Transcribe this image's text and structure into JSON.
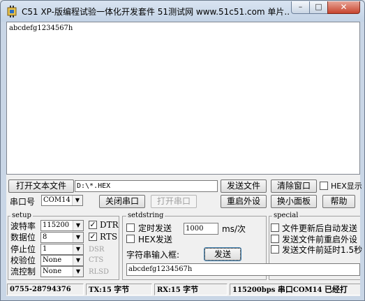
{
  "window": {
    "title": "C51 XP-版编程试验一体化开发套件 51测试网 www.51c51.com 单片...",
    "buttons": {
      "minimize": "–",
      "maximize": "□",
      "close": "✕"
    }
  },
  "receive_area": {
    "text": "abcdefg1234567h"
  },
  "row1": {
    "open_file_label": "打开文本文件",
    "file_path": "D:\\*.HEX",
    "send_file_label": "发送文件",
    "clear_window_label": "清除窗口",
    "hex_display_label": "HEX显示"
  },
  "row2": {
    "port_label": "串口号",
    "port_value": "COM14",
    "close_port_label": "关闭串口",
    "open_port_label": "打开串口",
    "restart_label": "重启外设",
    "mini_panel_label": "换小面板",
    "help_label": "帮助"
  },
  "setup": {
    "title": "setup",
    "baud_label": "波特率",
    "baud_value": "115200",
    "data_bits_label": "数据位",
    "data_bits_value": "8",
    "stop_bits_label": "停止位",
    "stop_bits_value": "1",
    "parity_label": "校验位",
    "parity_value": "None",
    "flow_label": "流控制",
    "flow_value": "None",
    "dtr_label": "DTR",
    "rts_label": "RTS",
    "dsr_label": "DSR",
    "cts_label": "CTS",
    "rlsd_label": "RLSD"
  },
  "setdstring": {
    "title": "setdstring",
    "timed_send_label": "定时发送",
    "interval_value": "1000",
    "interval_unit": "ms/次",
    "hex_send_label": "HEX发送",
    "input_label": "字符串输入框:",
    "send_label": "发送",
    "input_value": "abcdefg1234567h"
  },
  "special": {
    "title": "special",
    "opt1": "文件更新后自动发送",
    "opt2": "发送文件前重启外设",
    "opt3": "发送文件前延时1.5秒"
  },
  "status": {
    "phone": "0755-28794376",
    "tx_prefix": "TX:15",
    "tx_unit": "字节",
    "rx_prefix": "RX:15",
    "rx_unit": "字节",
    "baud_info": "115200bps",
    "port_prefix": "串口",
    "port_info": "COM14",
    "state": "已经打"
  },
  "colors": {
    "close_button": "#c7442e",
    "title_bar": "#c3d3e6"
  },
  "icons": {
    "app": "chip-icon",
    "check": "checkmark-glyph",
    "dropdown": "chevron-down-icon"
  }
}
